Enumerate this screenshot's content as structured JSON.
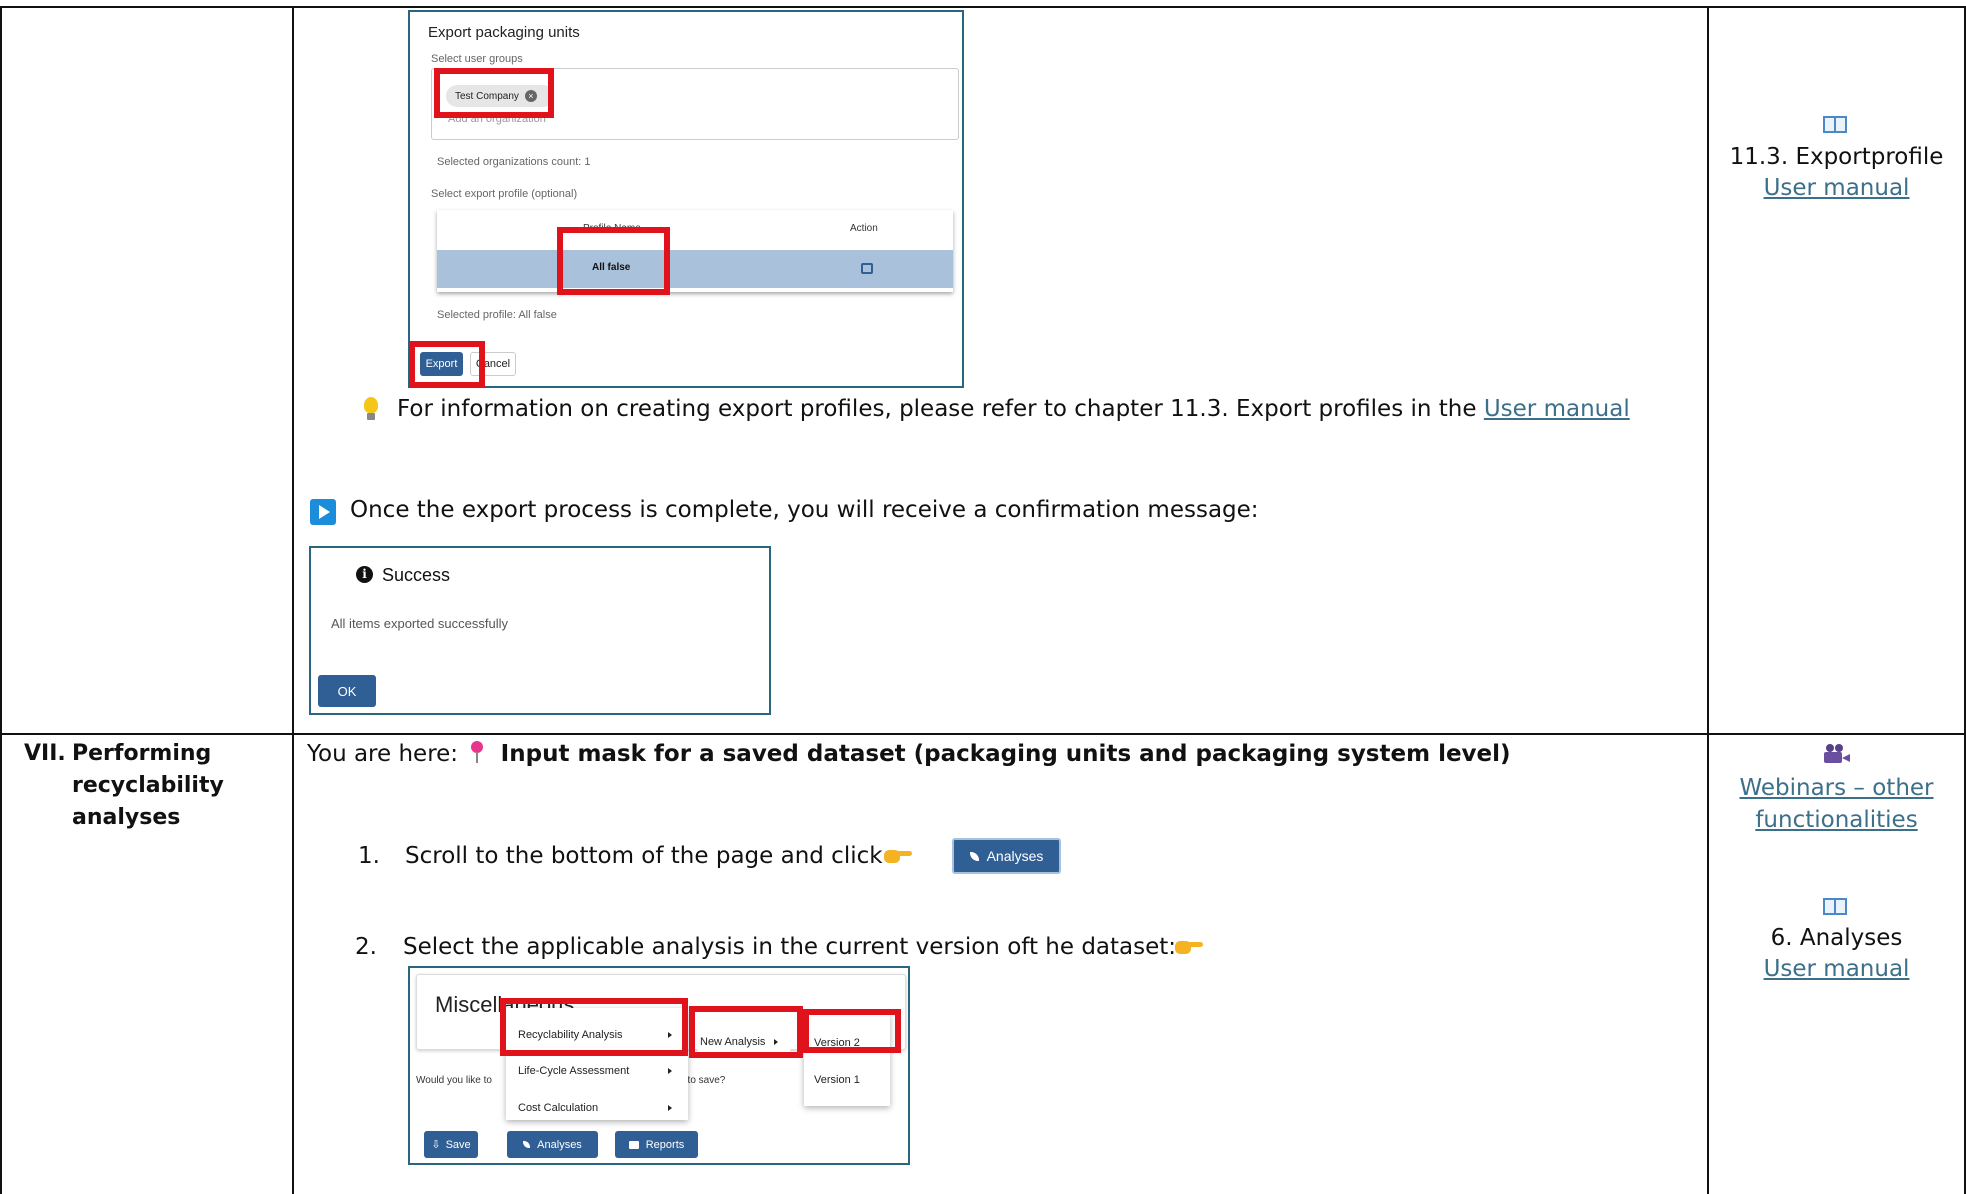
{
  "export_dialog": {
    "title": "Export packaging units",
    "user_groups_label": "Select user groups",
    "chip": "Test Company",
    "add_org_placeholder": "Add an organization",
    "count_text": "Selected organizations count: 1",
    "profile_label": "Select export profile (optional)",
    "col_profile": "Profile Name",
    "col_action": "Action",
    "row_profile": "All false",
    "selected_profile": "Selected profile: All false",
    "export_btn": "Export",
    "cancel_btn": "Cancel"
  },
  "tip": {
    "text": "For information on creating export profiles, please refer to chapter 11.3. Export profiles in the ",
    "link": "User manual"
  },
  "confirm": {
    "text": "Once the export process is complete, you will receive a confirmation message:"
  },
  "success_dialog": {
    "title": "Success",
    "message": "All items exported successfully",
    "ok": "OK"
  },
  "right_col_top": {
    "ref": "11.3. Exportprofile",
    "link": "User manual"
  },
  "section_vii": {
    "num": "VII.",
    "line1": "Performing",
    "line2": "recyclability",
    "line3": "analyses",
    "you_are_here": "You are here:",
    "location": "Input mask for a saved dataset (packaging units and packaging system level)",
    "step1_num": "1.",
    "step1": "Scroll to the bottom of the page and click",
    "analyses_btn": "Analyses",
    "step2_num": "2.",
    "step2": "Select the applicable analysis in the current version oft he dataset:"
  },
  "menu_shot": {
    "heading": "Miscellaneous",
    "item_recyclability": "Recyclability Analysis",
    "item_lca": "Life-Cycle Assessment",
    "item_cost": "Cost Calculation",
    "new_analysis": "New Analysis",
    "version2": "Version 2",
    "version1": "Version 1",
    "question_a": "Would you like to",
    "question_b": "t to save?",
    "save": "Save",
    "analyses": "Analyses",
    "reports": "Reports"
  },
  "right_col_bottom": {
    "webinars_link_1": "Webinars – other",
    "webinars_link_2": "functionalities",
    "ref": "6. Analyses",
    "link": "User manual"
  },
  "icons": [
    "book-icon",
    "film-camera-icon",
    "lightbulb-icon",
    "play-button-icon",
    "pushpin-icon",
    "pointing-hand-icon",
    "info-icon",
    "close-circle-icon",
    "edit-icon",
    "leaf-icon",
    "save-icon",
    "folder-icon",
    "caret-right-icon"
  ]
}
